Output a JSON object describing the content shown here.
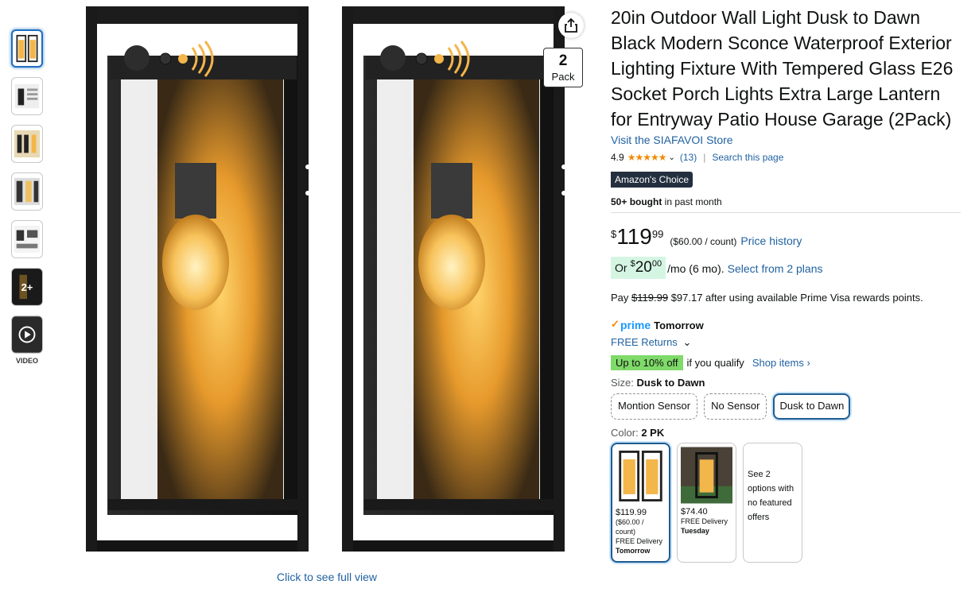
{
  "thumbnails": [
    {
      "name": "thumb-1"
    },
    {
      "name": "thumb-2"
    },
    {
      "name": "thumb-3"
    },
    {
      "name": "thumb-4"
    },
    {
      "name": "thumb-5"
    },
    {
      "name": "thumb-6"
    },
    {
      "name": "thumb-7"
    }
  ],
  "thumb_more_label": "2+",
  "video_label": "VIDEO",
  "main_image": {
    "badge_number": "2",
    "badge_text": "Pack",
    "full_view": "Click to see full view"
  },
  "product": {
    "title": "20in Outdoor Wall Light Dusk to Dawn Black Modern Sconce Waterproof Exterior Lighting Fixture With Tempered Glass E26 Socket Porch Lights Extra Large Lantern for Entryway Patio House Garage (2Pack)",
    "store_link": "Visit the SIAFAVOI Store",
    "rating": "4.9",
    "stars": "★★★★★",
    "review_count": "(13)",
    "search_page": "Search this page",
    "badge": "Amazon's Choice",
    "bought_bold": "50+ bought",
    "bought_rest": " in past month"
  },
  "price": {
    "currency": "$",
    "whole": "119",
    "fraction": "99",
    "per_unit": "($60.00 / count)",
    "history": "Price history",
    "monthly_or": "Or",
    "monthly_currency": "$",
    "monthly_whole": "20",
    "monthly_fraction": "00",
    "monthly_term": "/mo (6 mo).",
    "plans": "Select from 2 plans",
    "pay_prefix": "Pay",
    "pay_strike": "$119.99",
    "pay_rest": "$97.17 after using available Prime Visa rewards points."
  },
  "delivery": {
    "prime": "prime",
    "when": "Tomorrow",
    "returns": "FREE Returns"
  },
  "deal": {
    "badge": "Up to 10% off",
    "qualify": "if you qualify",
    "shop": "Shop items ›"
  },
  "size": {
    "label": "Size:",
    "selected": "Dusk to Dawn",
    "options": [
      "Montion Sensor",
      "No Sensor",
      "Dusk to Dawn"
    ]
  },
  "color": {
    "label": "Color:",
    "selected": "2 PK",
    "swatches": [
      {
        "price": "$119.99",
        "unit": "($60.00 / count)",
        "delivery": "FREE Delivery",
        "day": "Tomorrow"
      },
      {
        "price": "$74.40",
        "unit": "",
        "delivery": "FREE Delivery",
        "day": "Tuesday"
      }
    ],
    "more_text": "See 2 options with no featured offers"
  },
  "colors": {
    "link": "#2162a1",
    "selected_border": "#1e5b8f",
    "star": "#f38a00",
    "deal_green": "#7fda69"
  }
}
